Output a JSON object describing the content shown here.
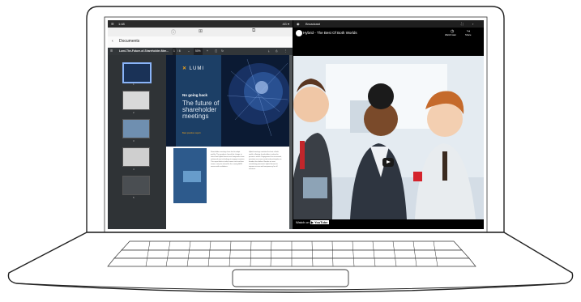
{
  "left_app": {
    "status_time": "1:48",
    "status_right": "4G ▾",
    "address_icons": [
      "info-icon",
      "grid-icon",
      "copy-icon"
    ],
    "back_label": "Documents",
    "pdf_filename": "Lumi-The-Future-of-Shareholder-Mee...",
    "page_indicator": "1",
    "page_total": "/ 6",
    "zoom": "50%",
    "thumb_numbers": [
      "1",
      "2",
      "3",
      "4",
      "5"
    ],
    "cover": {
      "brand": "LUMI",
      "line1": "No going back",
      "title": "The future of shareholder meetings",
      "subtitle": "Best practice report"
    },
    "para_left": "Shareholder meetings have had to adapt quickly. The pandemic forced the change to virtual and hybrid formats and companies have embraced new technology to engage investors. This report looks at what comes next and how issuers can plan ahead for the coming AGM season with confidence.",
    "para_right": "Hybrid meetings combine the best of both worlds, allowing shareholders to attend in person or online. Engagement has increased, questions are more varied and participation is broader than before. Boards are now considering permanent hybrid formats to improve access and transparency for all investors."
  },
  "right_app": {
    "header_label": "Broadcast",
    "video_title": "Hybrid - The Best Of Both Worlds",
    "watch_later_label": "Watch later",
    "share_label": "Share",
    "watch_on_label": "Watch on",
    "youtube_label": "YouTube"
  }
}
